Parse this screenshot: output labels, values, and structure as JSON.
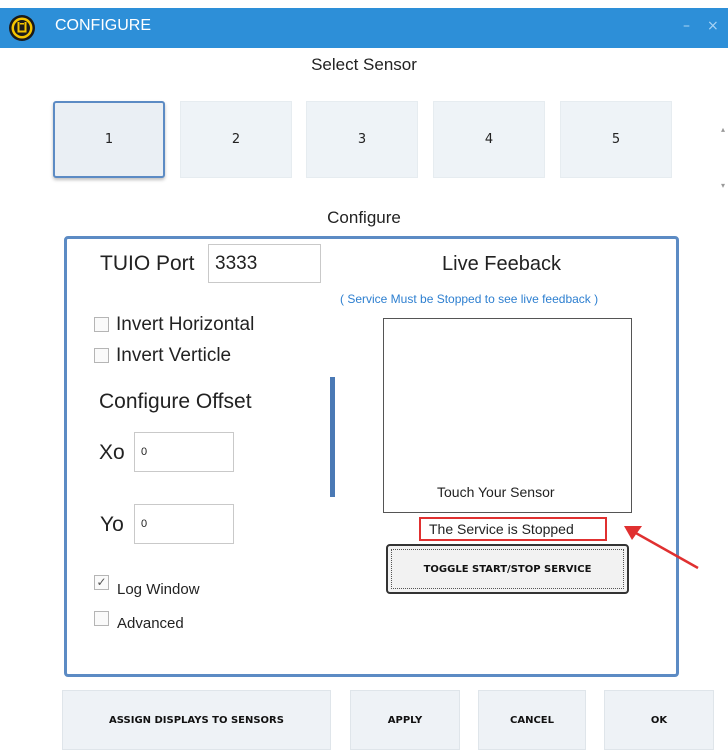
{
  "window": {
    "title": "CONFIGURE",
    "minimize": "–",
    "close": "×"
  },
  "colors": {
    "titlebar": "#2d8fd8",
    "accent": "#5c8bc4",
    "highlight": "#e03030"
  },
  "select_sensor": {
    "heading": "Select Sensor",
    "buttons": [
      "1",
      "2",
      "3",
      "4",
      "5"
    ],
    "selected": "1"
  },
  "configure": {
    "heading": "Configure",
    "tuio_port_label": "TUIO Port",
    "tuio_port_value": "3333",
    "invert_horizontal": {
      "label": "Invert Horizontal",
      "checked": false
    },
    "invert_verticle": {
      "label": "Invert Verticle",
      "checked": false
    },
    "offset_heading": "Configure Offset",
    "xo_label": "Xo",
    "xo_value": "0",
    "yo_label": "Yo",
    "yo_value": "0",
    "log_window": {
      "label": "Log Window",
      "checked": true,
      "mark": "✓"
    },
    "advanced": {
      "label": "Advanced",
      "checked": false
    }
  },
  "live_feedback": {
    "heading": "Live Feeback",
    "note": "( Service Must be Stopped to see live feedback )",
    "touch_text": "Touch Your Sensor",
    "status": "The Service is Stopped",
    "toggle_button": "TOGGLE START/STOP SERVICE"
  },
  "footer": {
    "assign_button": "ASSIGN DISPLAYS TO SENSORS",
    "apply_button": "APPLY",
    "cancel_button": "CANCEL",
    "ok_button": "OK"
  }
}
